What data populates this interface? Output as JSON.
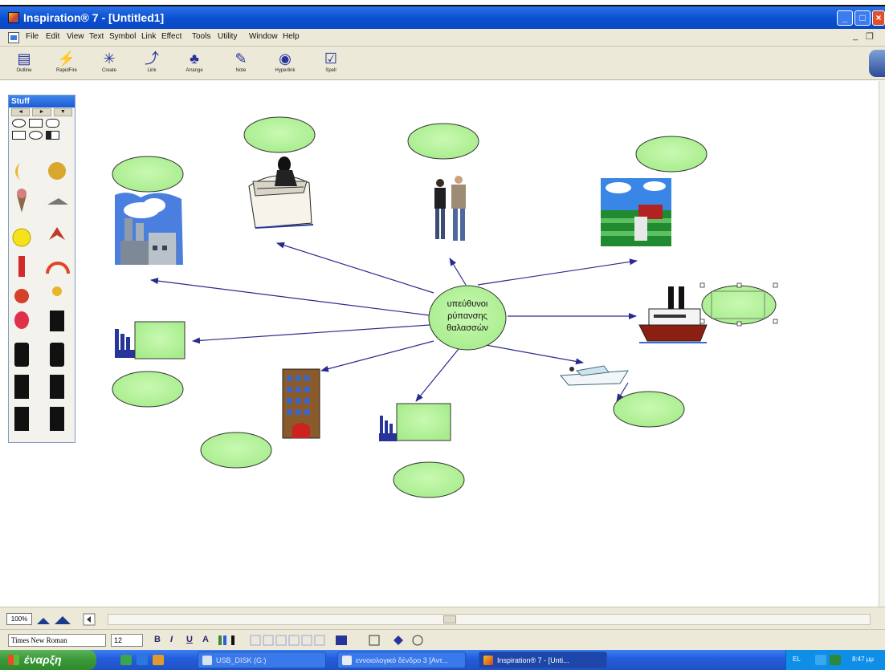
{
  "window": {
    "title": "Inspiration® 7 - [Untitled1]",
    "controls": [
      "minimize",
      "maximize",
      "close"
    ]
  },
  "menubar": {
    "items": [
      "File",
      "Edit",
      "View",
      "Text",
      "Symbol",
      "Link",
      "Effect",
      "Tools",
      "Utility",
      "Window",
      "Help"
    ]
  },
  "toolbar": {
    "buttons": [
      {
        "label": "Outline",
        "icon": "outline-icon"
      },
      {
        "label": "RapidFire",
        "icon": "rapidfire-icon"
      },
      {
        "label": "Create",
        "icon": "create-icon"
      },
      {
        "label": "Link",
        "icon": "link-icon"
      },
      {
        "label": "Arrange",
        "icon": "arrange-icon"
      },
      {
        "label": "Note",
        "icon": "note-icon"
      },
      {
        "label": "Hyperlink",
        "icon": "hyperlink-icon"
      },
      {
        "label": "Spell",
        "icon": "spell-icon"
      }
    ]
  },
  "palette": {
    "title": "Stuff",
    "nav": [
      "◄",
      "►",
      "▼"
    ]
  },
  "diagram": {
    "main_idea": [
      "υπεύθυνοι",
      "ρύπανσης",
      "θαλασσών"
    ],
    "colors": {
      "node_fill": "#b7f49e",
      "node_stroke": "#3a3a3a",
      "link_color": "#2a2a8c"
    }
  },
  "zoom": {
    "value": "100%"
  },
  "formatbar": {
    "font": "Times New Roman",
    "size": "12",
    "buttons": [
      "B",
      "I",
      "U",
      "A"
    ]
  },
  "taskbar": {
    "start_label": "έναρξη",
    "tasks": [
      {
        "label": "USB_DISK (G:)",
        "active": false
      },
      {
        "label": "εννοιολογικό δένδρο 3 [Αντ...",
        "active": false
      },
      {
        "label": "Inspiration® 7 - [Unti...",
        "active": true
      }
    ],
    "language": "EL",
    "clock": "8:47 μμ"
  }
}
